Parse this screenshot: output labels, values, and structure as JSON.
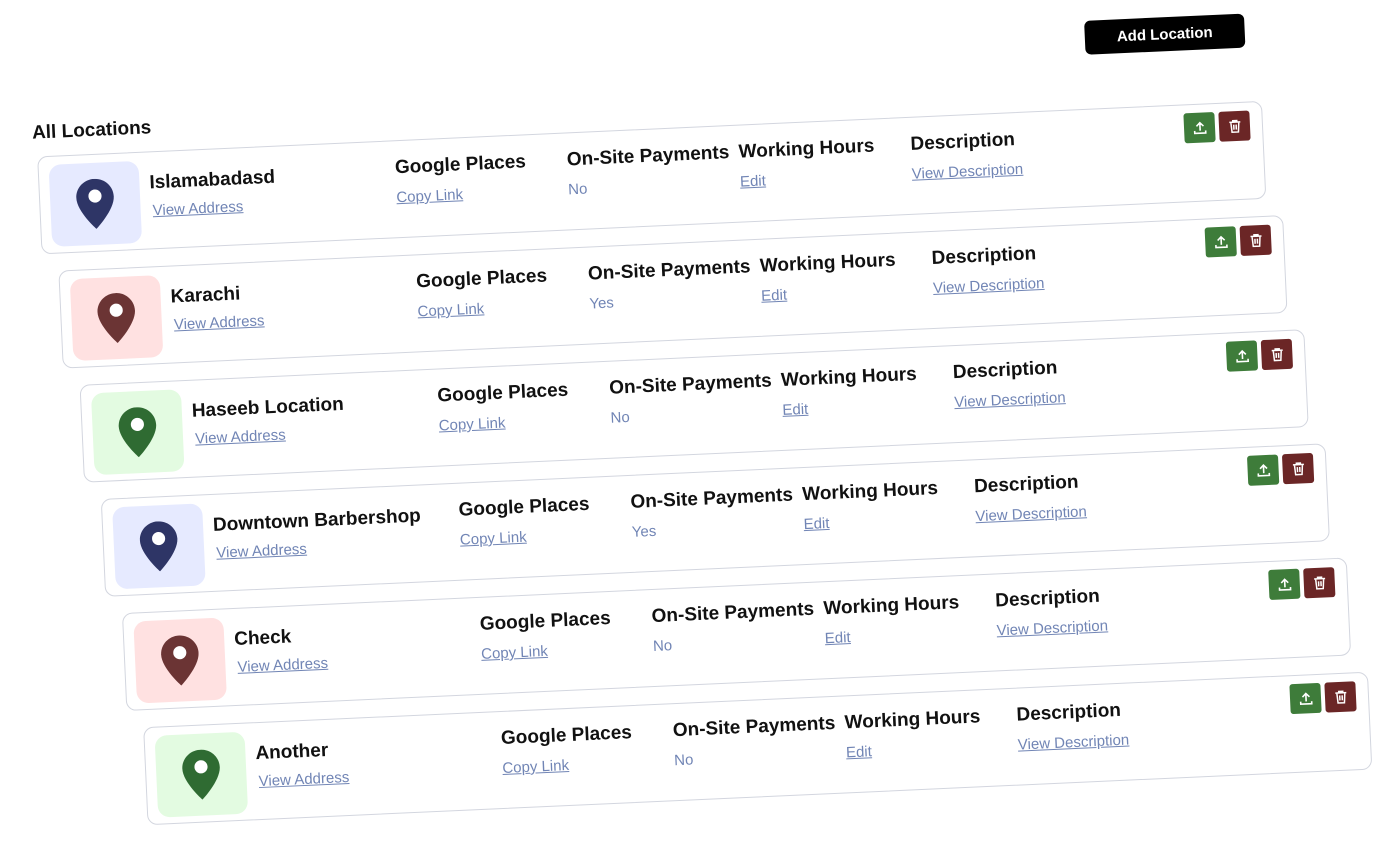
{
  "header": {
    "add_label": "Add Location",
    "title": "All Locations"
  },
  "columns": {
    "google": "Google Places",
    "payments": "On-Site Payments",
    "hours": "Working Hours",
    "description": "Description"
  },
  "links": {
    "view_address": "View Address",
    "copy_link": "Copy Link",
    "edit": "Edit",
    "view_description": "View Description"
  },
  "icons": {
    "pin": "map-pin-icon",
    "upload": "upload-icon",
    "delete": "trash-icon"
  },
  "colors": {
    "blue_pin": "#2e3566",
    "blue_bg": "#e6eaff",
    "red_pin": "#6b3434",
    "red_bg": "#ffe1e1",
    "green_pin": "#2f6b32",
    "green_bg": "#e3fbe1",
    "upload_btn": "#3e7c3a",
    "delete_btn": "#6b2626"
  },
  "locations": [
    {
      "name": "Islamabadasd",
      "payments": "No",
      "theme": "blue"
    },
    {
      "name": "Karachi",
      "payments": "Yes",
      "theme": "red"
    },
    {
      "name": "Haseeb Location",
      "payments": "No",
      "theme": "green"
    },
    {
      "name": "Downtown Barbershop",
      "payments": "Yes",
      "theme": "blue"
    },
    {
      "name": "Check",
      "payments": "No",
      "theme": "red"
    },
    {
      "name": "Another",
      "payments": "No",
      "theme": "green"
    }
  ]
}
